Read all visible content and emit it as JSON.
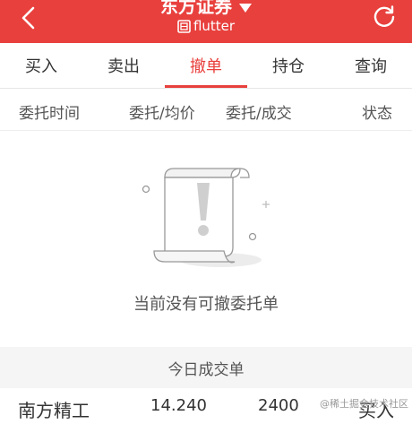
{
  "header": {
    "title": "东方证券",
    "subtitle": "flutter",
    "colors": {
      "bar": "#e8403d",
      "text": "#ffffff"
    }
  },
  "tabs": [
    {
      "label": "买入",
      "active": false
    },
    {
      "label": "卖出",
      "active": false
    },
    {
      "label": "撤单",
      "active": true
    },
    {
      "label": "持仓",
      "active": false
    },
    {
      "label": "查询",
      "active": false
    }
  ],
  "columns": [
    "委托时间",
    "委托/均价",
    "委托/成交",
    "状态"
  ],
  "empty_state": {
    "message": "当前没有可撤委托单"
  },
  "today": {
    "title": "今日成交单",
    "row": {
      "name": "南方精工",
      "price": "14.240",
      "volume": "2400",
      "status": "买入"
    }
  },
  "watermark": "@稀土掘金技术社区",
  "accent_color": "#e8403d"
}
